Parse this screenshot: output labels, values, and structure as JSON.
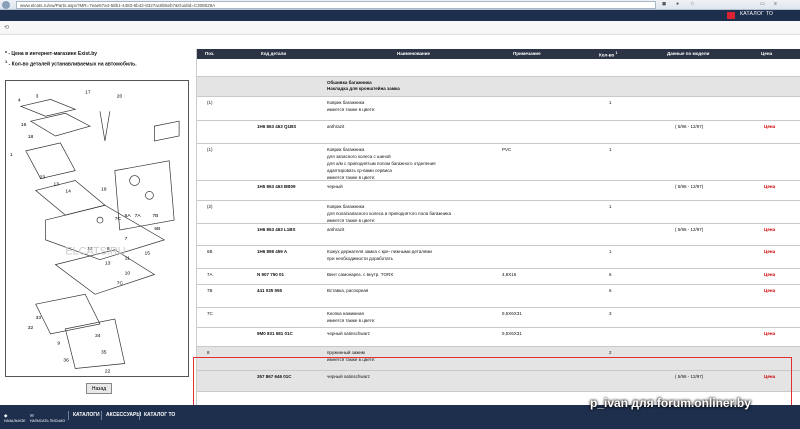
{
  "browser": {
    "url": "www.elcats.ru/vw/Parts.aspx?MR=7eae57a4-58b1-4483-6b42-8327ac8b5eb7&GuidId=C308529A",
    "catalog_logo": "КАТАЛОГ ТО"
  },
  "page": {
    "legend_price": "- Цена в интернет-магазине Exist.by",
    "legend_qty": "- Кол-во деталей устанавливаемых на автомобиль.",
    "legend_qty_mark": "1",
    "legend_price_mark": "*",
    "back_button": "Назад",
    "diagram_callouts": [
      "4",
      "3",
      "17",
      "20",
      "16",
      "18",
      "1",
      "13",
      "23",
      "14",
      "19",
      "7C",
      "6A",
      "7A",
      "7B",
      "6B",
      "12",
      "8",
      "7",
      "13",
      "11",
      "15",
      "10",
      "7C",
      "33",
      "32",
      "34",
      "35",
      "9",
      "36",
      "22"
    ],
    "diagram_watermark": "ELCATS.RU"
  },
  "table": {
    "headers": [
      "Поз.",
      "Код детали",
      "Наименование",
      "Примечание",
      "Кол-во",
      "Данные по модели",
      "Цена"
    ],
    "headers_qty_mark": "1",
    "group_title_1": "Обшивка багажника",
    "group_title_2": "Накладка для кронштейна замка",
    "rows": [
      {
        "pos": "(1)",
        "code": "",
        "name": [
          "Коврик багажника",
          "имеется также в цвете:"
        ],
        "note": "",
        "qty": "1",
        "model": "",
        "price": ""
      },
      {
        "pos": "",
        "code": "1H6 863 463 Q1BS",
        "name": [
          "anthrazit"
        ],
        "note": "",
        "qty": "",
        "model": "( 5/96 - 12/97)",
        "price": "Цена"
      },
      {
        "pos": "(1)",
        "code": "",
        "name": [
          "Коврик багажника",
          "для запасного колеса с шиной",
          "для а/м с приподнятым полом багажного отделения",
          "адаптировать ср-вами сервиса",
          "имеется также в цвете:"
        ],
        "note": "PVC",
        "qty": "1",
        "model": "",
        "price": ""
      },
      {
        "pos": "",
        "code": "1H5 863 463 BB09",
        "name": [
          "черный"
        ],
        "note": "",
        "qty": "",
        "model": "( 5/96 - 12/97)",
        "price": "Цена"
      },
      {
        "pos": "(2)",
        "code": "",
        "name": [
          "Коврик багажника",
          "для пола/запасного колеса и приподнятого пола багажника",
          "имеется также в цвете:"
        ],
        "note": "",
        "qty": "1",
        "model": "",
        "price": ""
      },
      {
        "pos": "",
        "code": "1H6 863 463 L1BS",
        "name": [
          "anthrazit"
        ],
        "note": "",
        "qty": "",
        "model": "( 5/96 - 12/97)",
        "price": "Цена"
      },
      {
        "pos": "6B",
        "code": "1H6 898 459 A",
        "name": [
          "Кожух держателя замка с кре- пежными деталями",
          "при необходимости доработать"
        ],
        "note": "",
        "qty": "1",
        "model": "",
        "price": "Цена"
      },
      {
        "pos": "7A",
        "code": "N 907 750 01",
        "name": [
          "Винт самонарез. с внутр. TORX"
        ],
        "note": "4,8X16",
        "qty": "6",
        "model": "",
        "price": "Цена"
      },
      {
        "pos": "7B",
        "code": "441 035 555",
        "name": [
          "Вставка, распорная"
        ],
        "note": "",
        "qty": "6",
        "model": "",
        "price": "Цена"
      },
      {
        "pos": "7C",
        "code": "",
        "name": [
          "Кнопка нажимная",
          "имеется также в цвете:"
        ],
        "note": "9,5X6X31",
        "qty": "3",
        "model": "",
        "price": ""
      },
      {
        "pos": "",
        "code": "9M0 831 581 01C",
        "name": [
          "черный satinschwarz"
        ],
        "note": "9,5X6X31",
        "qty": "",
        "model": "",
        "price": "Цена"
      },
      {
        "pos": "8",
        "code": "",
        "name": [
          "пружинный зажим",
          "имеется также в цвете:"
        ],
        "note": "",
        "qty": "2",
        "model": "",
        "price": ""
      },
      {
        "pos": "",
        "code": "357 867 646 01C",
        "name": [
          "черный satinschwarz"
        ],
        "note": "",
        "qty": "",
        "model": "( 5/96 - 12/97)",
        "price": "Цена"
      }
    ]
  },
  "footer": {
    "icons": [
      "НАЧАЛЬНОЕ",
      "НАПИСАТЬ ПИСЬМО"
    ],
    "menu": [
      "КАТАЛОГИ",
      "АКСЕССУАРЫ",
      "КАТАЛОГ ТО"
    ]
  },
  "watermark": "p_ivan для forum.onliner.by",
  "colors": {
    "header_bg": "#2b3345",
    "nav_bg": "#1e2f4d",
    "price": "#cc0000",
    "highlight_border": "#e03030"
  }
}
